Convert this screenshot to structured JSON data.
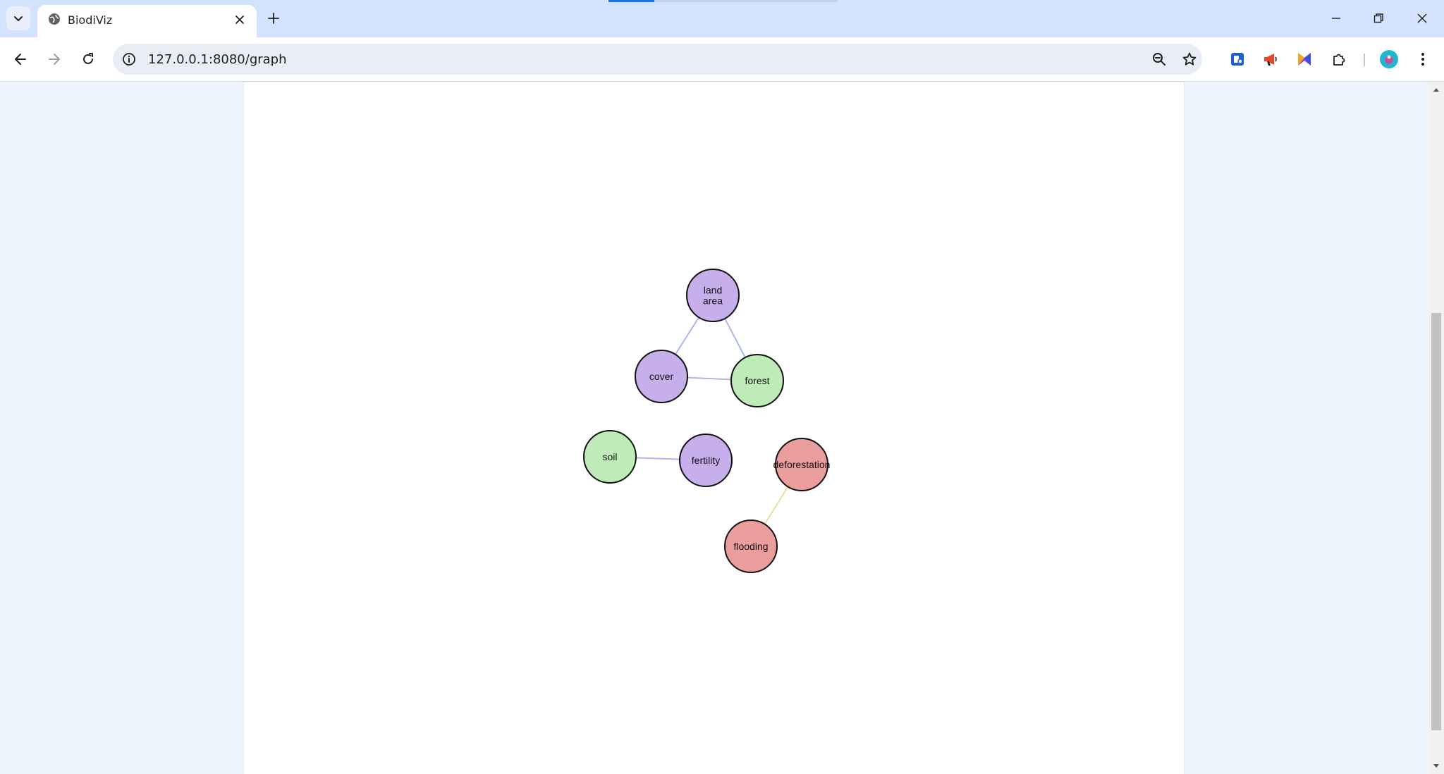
{
  "browser": {
    "tab": {
      "title": "BiodiViz"
    },
    "address_bar": {
      "url": "127.0.0.1:8080/graph"
    }
  },
  "colors": {
    "node_purple": "#c7afec",
    "node_green": "#bfebb8",
    "node_red": "#eb9c9c",
    "edge_blue": "#aab6e8",
    "edge_yellow": "#e2e39a"
  },
  "graph": {
    "nodes": [
      {
        "id": "land_area",
        "label_lines": [
          "land",
          "area"
        ],
        "color": "#c7afec"
      },
      {
        "id": "cover",
        "label_lines": [
          "cover"
        ],
        "color": "#c7afec"
      },
      {
        "id": "forest",
        "label_lines": [
          "forest"
        ],
        "color": "#bfebb8"
      },
      {
        "id": "soil",
        "label_lines": [
          "soil"
        ],
        "color": "#bfebb8"
      },
      {
        "id": "fertility",
        "label_lines": [
          "fertility"
        ],
        "color": "#c7afec"
      },
      {
        "id": "deforestation",
        "label_lines": [
          "deforestation"
        ],
        "color": "#eb9c9c"
      },
      {
        "id": "flooding",
        "label_lines": [
          "flooding"
        ],
        "color": "#eb9c9c"
      }
    ],
    "edges": [
      {
        "source": "land_area",
        "target": "cover",
        "color": "#aab6e8"
      },
      {
        "source": "land_area",
        "target": "forest",
        "color": "#aab6e8"
      },
      {
        "source": "cover",
        "target": "forest",
        "color": "#aab6e8"
      },
      {
        "source": "soil",
        "target": "fertility",
        "color": "#aab6e8"
      },
      {
        "source": "deforestation",
        "target": "flooding",
        "color": "#e2e39a"
      }
    ]
  }
}
